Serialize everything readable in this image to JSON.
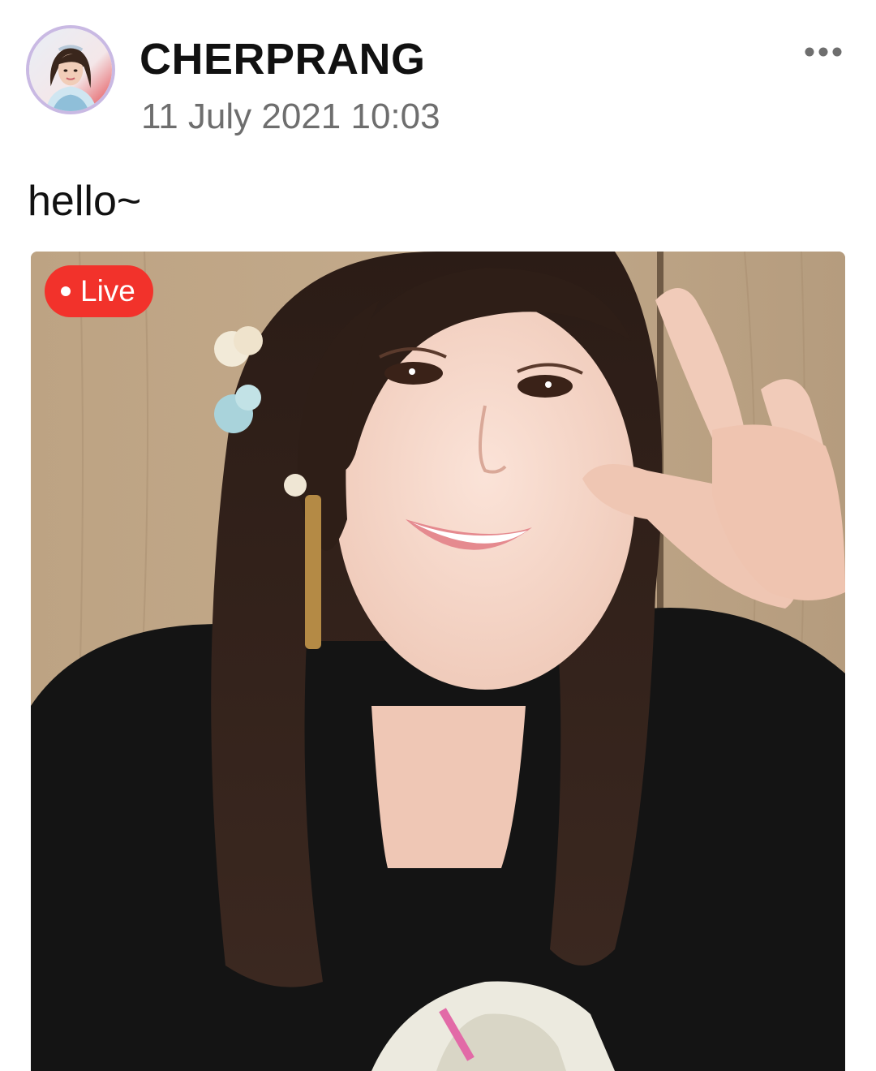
{
  "post": {
    "author": {
      "name": "CHERPRANG",
      "avatar_alt": "profile photo"
    },
    "timestamp": "11 July 2021 10:03",
    "text": "hello~",
    "media": {
      "type": "live-photo",
      "badge_label": "Live",
      "badge_color": "#f2322b"
    },
    "more_icon": "more-horizontal-icon"
  }
}
